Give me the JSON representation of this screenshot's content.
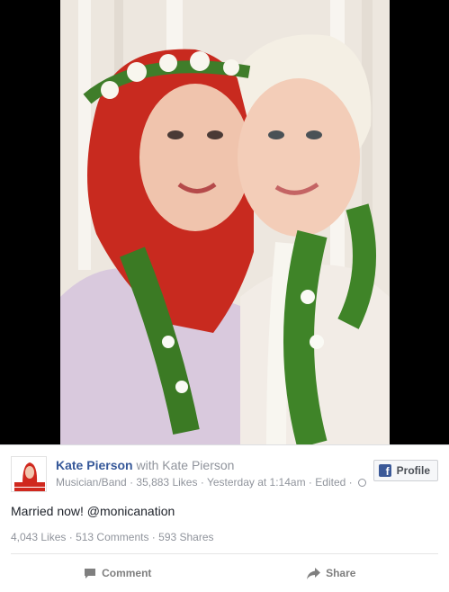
{
  "post": {
    "page_name": "Kate Pierson",
    "with_text": "with",
    "tagged_name": "Kate Pierson",
    "category": "Musician/Band",
    "likes_page": "35,883 Likes",
    "timestamp": "Yesterday at 1:14am",
    "edited": "Edited",
    "message": "Married now! @monicanation",
    "likes": "4,043 Likes",
    "comments": "513 Comments",
    "shares": "593 Shares",
    "avatar_caption": "Kate Pierson"
  },
  "buttons": {
    "profile": "Profile",
    "comment": "Comment",
    "share": "Share"
  },
  "icons": {
    "facebook": "f",
    "comment": "comment-icon",
    "share": "share-icon",
    "privacy": "globe-icon"
  },
  "colors": {
    "link_blue": "#365899",
    "facebook_blue": "#3b5998",
    "meta_gray": "#90949c"
  }
}
